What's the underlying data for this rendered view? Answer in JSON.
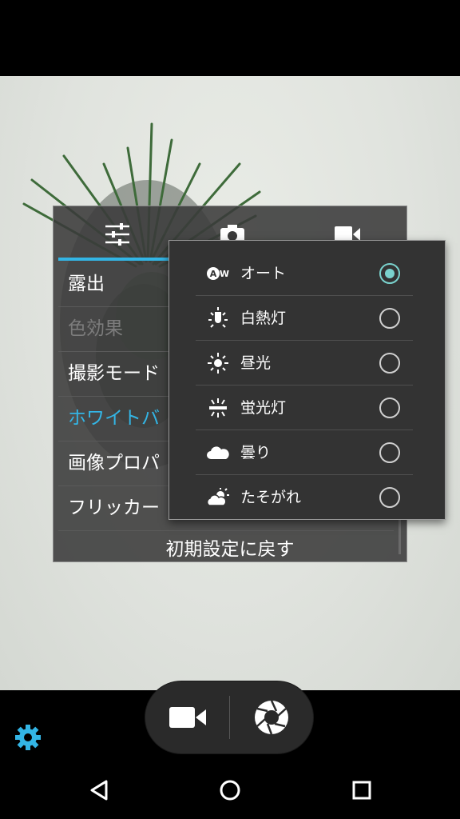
{
  "settings_panel": {
    "tabs": [
      {
        "name": "settings-sliders",
        "icon": "sliders-icon"
      },
      {
        "name": "camera",
        "icon": "camera-icon"
      },
      {
        "name": "video",
        "icon": "video-icon"
      }
    ],
    "items": [
      {
        "label": "露出",
        "state": "normal"
      },
      {
        "label": "色効果",
        "state": "disabled"
      },
      {
        "label": "撮影モード",
        "state": "normal"
      },
      {
        "label": "ホワイトバ",
        "state": "active"
      },
      {
        "label": "画像プロパ",
        "state": "normal"
      },
      {
        "label": "フリッカー",
        "state": "normal"
      }
    ],
    "reset_label": "初期設定に戻す"
  },
  "white_balance_popup": {
    "options": [
      {
        "label": "オート",
        "icon": "auto-wb-icon",
        "selected": true
      },
      {
        "label": "白熱灯",
        "icon": "incandescent-icon",
        "selected": false
      },
      {
        "label": "昼光",
        "icon": "daylight-icon",
        "selected": false
      },
      {
        "label": "蛍光灯",
        "icon": "fluorescent-icon",
        "selected": false
      },
      {
        "label": "曇り",
        "icon": "cloudy-icon",
        "selected": false
      },
      {
        "label": "たそがれ",
        "icon": "twilight-icon",
        "selected": false
      }
    ],
    "accent_color": "#7ad2cd"
  },
  "controls": {
    "video_button_icon": "video-camera-icon",
    "shutter_button_icon": "shutter-icon",
    "settings_icon": "gear-icon",
    "accent_color": "#33b5e5"
  },
  "nav": {
    "back_icon": "back-triangle-icon",
    "home_icon": "home-circle-icon",
    "recents_icon": "recents-square-icon"
  }
}
